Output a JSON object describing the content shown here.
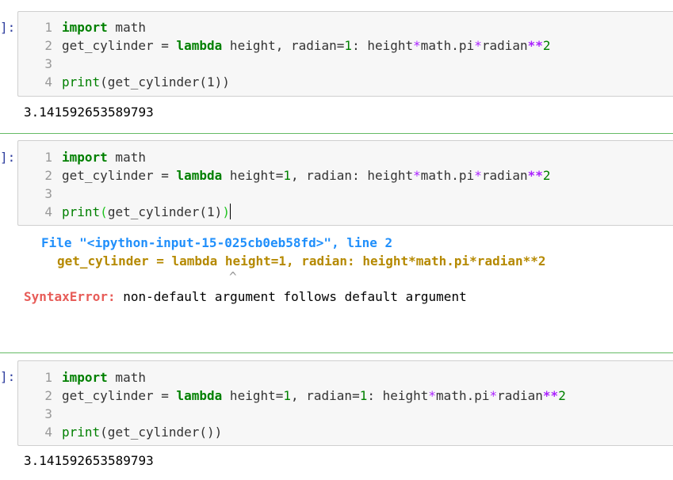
{
  "colors": {
    "prompt": "#303f9f",
    "keyword": "#008000",
    "operator": "#aa22ff",
    "number": "#008000",
    "bracket_match": "#1ec31e",
    "traceback_file": "#208ffb",
    "traceback_code": "#b58900",
    "error_name": "#e75c58",
    "cell_separator": "#66bb66",
    "input_bg": "#f7f7f7"
  },
  "cells": [
    {
      "prompt": "]:",
      "line_numbers": [
        "1",
        "2",
        "3",
        "4"
      ],
      "code": {
        "l1_kw": "import",
        "l1_rest": " math",
        "l2_a": "get_cylinder = ",
        "l2_kw": "lambda",
        "l2_b": " height, radian=",
        "l2_n1": "1",
        "l2_c": ": height",
        "l2_op1": "*",
        "l2_d": "math.pi",
        "l2_op2": "*",
        "l2_e": "radian",
        "l2_op3": "**",
        "l2_n2": "2",
        "l4_fn": "print",
        "l4_rest": "(get_cylinder(1))"
      },
      "output": "3.141592653589793"
    },
    {
      "prompt": "]:",
      "line_numbers": [
        "1",
        "2",
        "3",
        "4"
      ],
      "code": {
        "l1_kw": "import",
        "l1_rest": " math",
        "l2_a": "get_cylinder = ",
        "l2_kw": "lambda",
        "l2_b": " height=",
        "l2_n1": "1",
        "l2_c": ", radian: height",
        "l2_op1": "*",
        "l2_d": "math.pi",
        "l2_op2": "*",
        "l2_e": "radian",
        "l2_op3": "**",
        "l2_n2": "2",
        "l4_fn": "print",
        "l4_open": "(",
        "l4_mid": "get_cylinder(1)",
        "l4_close": ")"
      },
      "traceback": {
        "file_label": "File ",
        "file_name": "\"<ipython-input-15-025cb0eb58fd>\"",
        "line_label": ", line 2",
        "code_line": "get_cylinder = lambda height=1, radian: height*math.pi*radian**2",
        "caret": "^",
        "error_name": "SyntaxError:",
        "error_msg": " non-default argument follows default argument"
      }
    },
    {
      "prompt": "]:",
      "line_numbers": [
        "1",
        "2",
        "3",
        "4"
      ],
      "code": {
        "l1_kw": "import",
        "l1_rest": " math",
        "l2_a": "get_cylinder = ",
        "l2_kw": "lambda",
        "l2_b": " height=",
        "l2_n1": "1",
        "l2_c": ", radian=",
        "l2_n1b": "1",
        "l2_c2": ": height",
        "l2_op1": "*",
        "l2_d": "math.pi",
        "l2_op2": "*",
        "l2_e": "radian",
        "l2_op3": "**",
        "l2_n2": "2",
        "l4_fn": "print",
        "l4_rest": "(get_cylinder())"
      },
      "output": "3.141592653589793"
    }
  ]
}
